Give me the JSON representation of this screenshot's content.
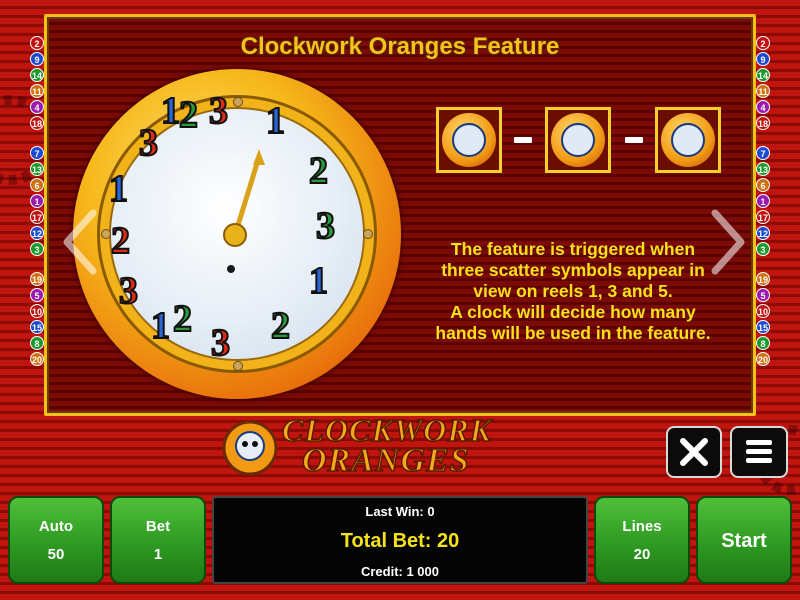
{
  "title": "Clockwork Oranges Feature",
  "logo": {
    "line1": "CLOCKWORK",
    "line2": "ORANGES"
  },
  "feature_text": [
    "The feature is triggered when",
    "three scatter symbols appear in",
    "view on reels 1, 3 and 5.",
    "A clock will decide how many",
    "hands will be used in the feature."
  ],
  "clock_numbers": [
    "3",
    "1",
    "2",
    "3",
    "1",
    "2",
    "3",
    "2",
    "1",
    "3",
    "2",
    "1",
    "3",
    "1",
    "2"
  ],
  "line_numbers_left": [
    "2",
    "9",
    "14",
    "11",
    "4",
    "18",
    "7",
    "13",
    "6",
    "1",
    "17",
    "12",
    "3",
    "19",
    "5",
    "10",
    "15",
    "8",
    "20"
  ],
  "line_numbers_right": [
    "2",
    "9",
    "14",
    "11",
    "4",
    "18",
    "7",
    "13",
    "6",
    "1",
    "17",
    "12",
    "3",
    "19",
    "5",
    "10",
    "15",
    "8",
    "20"
  ],
  "buttons": {
    "close_icon": "close-icon",
    "menu_icon": "menu-icon",
    "auto": {
      "label": "Auto",
      "value": "50"
    },
    "bet": {
      "label": "Bet",
      "value": "1"
    },
    "lines": {
      "label": "Lines",
      "value": "20"
    },
    "start": {
      "label": "Start"
    }
  },
  "info": {
    "last_win": "Last Win: 0",
    "total_bet": "Total Bet: 20",
    "credit": "Credit: 1 000"
  },
  "colors": {
    "accent_yellow": "#f6e21a",
    "panel_border": "#f3c21a",
    "button_green": "#2e9a22",
    "background_red": "#c0140e"
  }
}
